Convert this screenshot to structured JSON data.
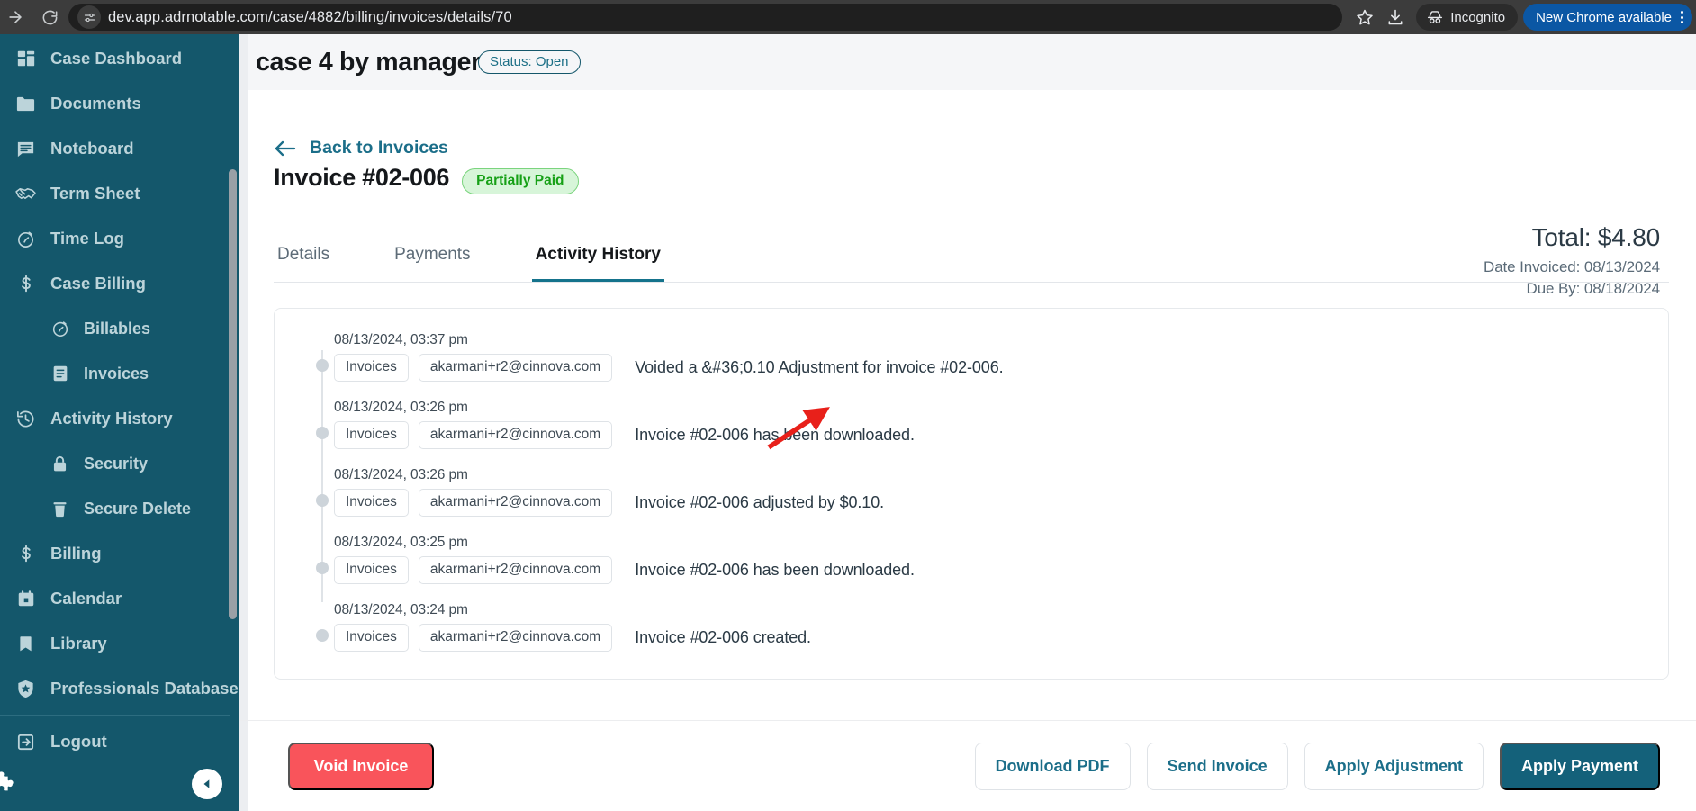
{
  "browser": {
    "url": "dev.app.adrnotable.com/case/4882/billing/invoices/details/70",
    "forward_icon": "forward-arrow-icon",
    "reload_icon": "reload-icon",
    "site_info_icon": "site-settings-icon",
    "bookmark_icon": "star-icon",
    "download_icon": "download-icon",
    "incognito_label": "Incognito",
    "incognito_icon": "incognito-icon",
    "new_chrome_label": "New Chrome available",
    "menu_icon": "kebab-menu-icon"
  },
  "sidebar": {
    "items": [
      {
        "label": "Case Dashboard",
        "icon": "dashboard-icon",
        "sub": false
      },
      {
        "label": "Documents",
        "icon": "folder-icon",
        "sub": false
      },
      {
        "label": "Noteboard",
        "icon": "note-icon",
        "sub": false
      },
      {
        "label": "Term Sheet",
        "icon": "handshake-icon",
        "sub": false
      },
      {
        "label": "Time Log",
        "icon": "stopwatch-icon",
        "sub": false
      },
      {
        "label": "Case Billing",
        "icon": "dollar-icon",
        "sub": false
      },
      {
        "label": "Billables",
        "icon": "stopwatch-icon",
        "sub": true
      },
      {
        "label": "Invoices",
        "icon": "invoice-icon",
        "sub": true
      },
      {
        "label": "Activity History",
        "icon": "history-icon",
        "sub": false
      },
      {
        "label": "Security",
        "icon": "lock-icon",
        "sub": true
      },
      {
        "label": "Secure Delete",
        "icon": "trash-icon",
        "sub": true
      },
      {
        "label": "Billing",
        "icon": "dollar-icon",
        "sub": false
      },
      {
        "label": "Calendar",
        "icon": "calendar-icon",
        "sub": false
      },
      {
        "label": "Library",
        "icon": "bookmark-icon",
        "sub": false
      },
      {
        "label": "Professionals Database",
        "icon": "badge-star-icon",
        "sub": false
      }
    ],
    "logout": {
      "label": "Logout",
      "icon": "logout-icon"
    },
    "collapse_icon": "chevron-left-icon",
    "puzzle_icon": "puzzle-piece-icon"
  },
  "case_header": {
    "title": "case 4 by manager",
    "status": "Status: Open"
  },
  "invoice": {
    "back_label": "Back to Invoices",
    "back_icon": "arrow-left-icon",
    "title": "Invoice #02-006",
    "status_badge": "Partially Paid",
    "total": "Total: $4.80",
    "date_invoiced": "Date Invoiced: 08/13/2024",
    "due_by": "Due By: 08/18/2024"
  },
  "tabs": [
    {
      "label": "Details",
      "active": false
    },
    {
      "label": "Payments",
      "active": false
    },
    {
      "label": "Activity History",
      "active": true
    }
  ],
  "activity": [
    {
      "time": "08/13/2024, 03:37 pm",
      "module": "Invoices",
      "user": "akarmani+r2@cinnova.com",
      "message": "Voided a &#36;0.10 Adjustment for invoice #02-006."
    },
    {
      "time": "08/13/2024, 03:26 pm",
      "module": "Invoices",
      "user": "akarmani+r2@cinnova.com",
      "message": "Invoice #02-006 has been downloaded."
    },
    {
      "time": "08/13/2024, 03:26 pm",
      "module": "Invoices",
      "user": "akarmani+r2@cinnova.com",
      "message": "Invoice #02-006 adjusted by $0.10."
    },
    {
      "time": "08/13/2024, 03:25 pm",
      "module": "Invoices",
      "user": "akarmani+r2@cinnova.com",
      "message": "Invoice #02-006 has been downloaded."
    },
    {
      "time": "08/13/2024, 03:24 pm",
      "module": "Invoices",
      "user": "akarmani+r2@cinnova.com",
      "message": "Invoice #02-006 created."
    }
  ],
  "footer": {
    "void": "Void Invoice",
    "download_pdf": "Download PDF",
    "send_invoice": "Send Invoice",
    "apply_adjustment": "Apply Adjustment",
    "apply_payment": "Apply Payment"
  },
  "colors": {
    "sidebar": "#14576b",
    "accent": "#14617a",
    "danger": "#f9545b",
    "success": "#16a016",
    "annotation": "#e8201a"
  }
}
